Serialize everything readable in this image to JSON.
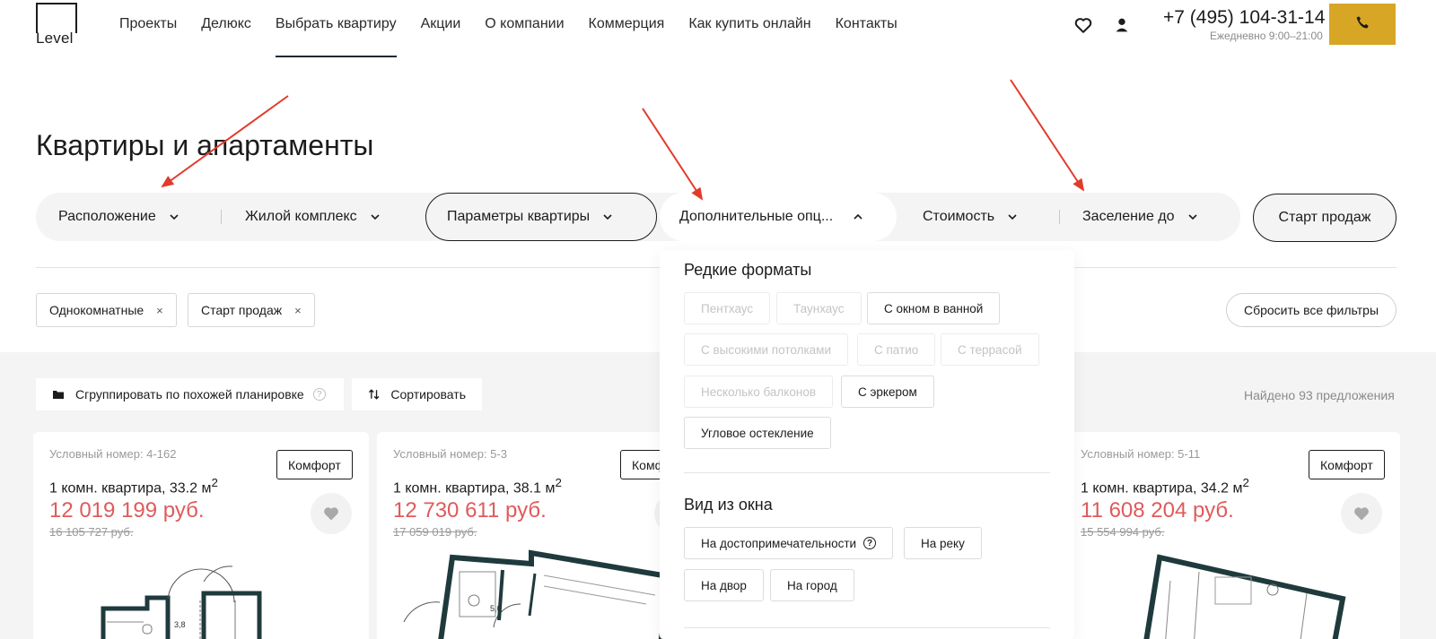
{
  "brand": {
    "logo_text": "Level"
  },
  "nav": {
    "items": [
      {
        "label": "Проекты"
      },
      {
        "label": "Делюкс"
      },
      {
        "label": "Выбрать квартиру",
        "active": true
      },
      {
        "label": "Акции"
      },
      {
        "label": "О компании"
      },
      {
        "label": "Коммерция"
      },
      {
        "label": "Как купить онлайн"
      },
      {
        "label": "Контакты"
      }
    ]
  },
  "header": {
    "phone": "+7 (495) 104-31-14",
    "hours": "Ежедневно 9:00–21:00",
    "accent_color": "#d7a625"
  },
  "page": {
    "title": "Квартиры и апартаменты"
  },
  "filters": {
    "location": "Расположение",
    "complex": "Жилой комплекс",
    "params": "Параметры квартиры",
    "extra": "Дополнительные опц...",
    "price": "Стоимость",
    "move_in": "Заселение до",
    "start_sales": "Старт продаж"
  },
  "chips": {
    "one_room": "Однокомнатные",
    "start_sales": "Старт продаж",
    "remove_symbol": "×",
    "reset_all": "Сбросить все фильтры"
  },
  "toolbar": {
    "group_label": "Сгруппировать по похожей планировке",
    "help_symbol": "?",
    "sort_label": "Сортировать",
    "found_text": "Найдено 93 предложения"
  },
  "cards": [
    {
      "num": "Условный номер: 4-162",
      "title": "1 комн. квартира, 33.2 м",
      "price": "12 019 199 руб.",
      "old_price": "16 105 727 руб.",
      "badge": "Комфорт",
      "room_size": "3,8"
    },
    {
      "num": "Условный номер: 5-3",
      "title": "1 комн. квартира, 38.1 м",
      "price": "12 730 611 руб.",
      "old_price": "17 059 019 руб.",
      "badge": "Комфорт",
      "room_size": "5,0"
    },
    {
      "num": "Условный номер: 5-11",
      "title": "1 комн. квартира, 34.2 м",
      "price": "11 608 204 руб.",
      "old_price": "15 554 994 руб.",
      "badge": "Комфорт"
    }
  ],
  "units": {
    "sup": "2"
  },
  "dropdown": {
    "rare_title": "Редкие форматы",
    "rare": {
      "penthouse": "Пентхаус",
      "townhouse": "Таунхаус",
      "bath_window": "С окном в ванной",
      "high_ceilings": "С высокими потолками",
      "patio": "С патио",
      "terrace": "С террасой",
      "multi_balcony": "Несколько балконов",
      "bay_window": "С эркером",
      "corner_glazing": "Угловое остекление"
    },
    "view_title": "Вид из окна",
    "view": {
      "landmarks": "На достопримечательности",
      "river": "На реку",
      "yard": "На двор",
      "city": "На город"
    },
    "help_symbol": "?"
  },
  "colors": {
    "price": "#e05a5a",
    "annotation_arrow": "#e23b2b"
  }
}
